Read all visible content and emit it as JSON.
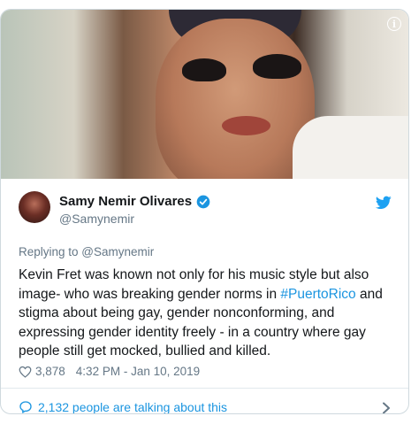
{
  "media": {
    "info_icon": "info-icon",
    "info_glyph": "i"
  },
  "author": {
    "name": "Samy Nemir Olivares",
    "handle": "@Samynemir",
    "verified": true,
    "avatar_icon": "avatar"
  },
  "replying_to": "Replying to @Samynemir",
  "tweet": {
    "text_before": "Kevin Fret was known not only for his music style but also image- who was breaking gender norms in ",
    "hashtag": "#PuertoRico",
    "text_after": " and stigma about being gay, gender nonconforming, and expressing gender identity freely - in a country where gay people still get mocked, bullied and killed."
  },
  "meta": {
    "likes": "3,878",
    "timestamp": "4:32 PM - Jan 10, 2019"
  },
  "footer": {
    "talking": "2,132 people are talking about this"
  },
  "colors": {
    "link": "#1b95e0",
    "text": "#14171a",
    "muted": "#657786",
    "border": "#cfd9de"
  }
}
